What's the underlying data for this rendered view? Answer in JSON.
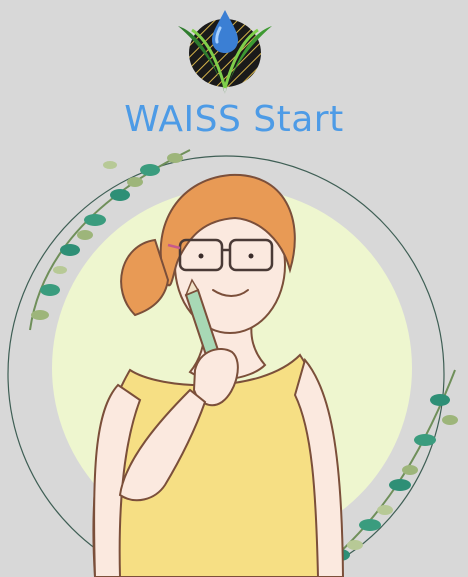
{
  "app": {
    "title": "WAISS Start",
    "logo_icon": "water-drop-leaf-logo",
    "illustration": "woman-thinking-with-pencil"
  },
  "colors": {
    "background": "#d8d8d8",
    "title": "#4d9be6",
    "circle_fill": "#eef6cf",
    "ring": "#3f5f55",
    "leaf": "#2e8f76",
    "hair": "#e89a55",
    "shirt": "#f6df84"
  }
}
